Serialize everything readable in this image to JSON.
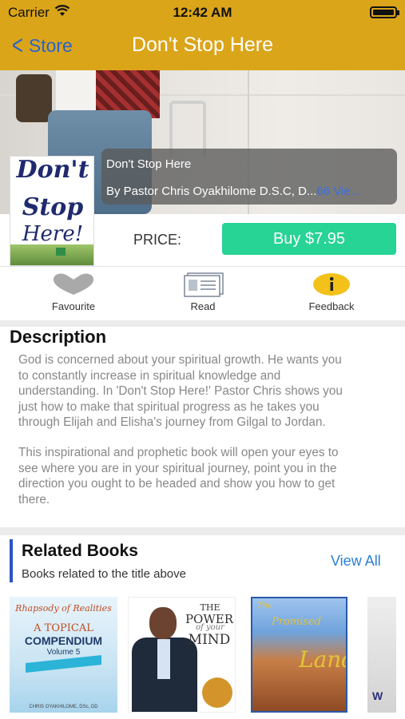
{
  "status_bar": {
    "carrier": "Carrier",
    "time": "12:42 AM"
  },
  "nav": {
    "back_label": "Store",
    "title": "Don't Stop Here"
  },
  "book": {
    "title": "Don't Stop Here",
    "author": "By Pastor Chris Oyakhilome D.S.C, D...",
    "views": "66 Vie...",
    "cover": {
      "line1": "Don't",
      "line2": "Stop",
      "line3": "Here!"
    }
  },
  "price": {
    "label": "PRICE:",
    "buy_label": "Buy $7.95"
  },
  "actions": [
    {
      "label": "Favourite",
      "icon": "heart-icon"
    },
    {
      "label": "Read",
      "icon": "book-icon"
    },
    {
      "label": "Feedback",
      "icon": "info-icon"
    }
  ],
  "description": {
    "heading": "Description",
    "paragraph1_lines": [
      "God is concerned about your spiritual growth. He wants you",
      "to constantly increase in spiritual knowledge and",
      "understanding. In 'Don't Stop Here!' Pastor Chris shows you",
      "just how to make that spiritual progress as he takes you",
      "through Elijah and Elisha's journey from Gilgal to Jordan."
    ],
    "paragraph2_lines": [
      "This inspirational and prophetic book will open your eyes to",
      "see where you are in your spiritual journey, point you in the",
      "direction you ought to be headed and show you how to get",
      "there."
    ]
  },
  "related": {
    "heading": "Related Books",
    "subheading": "Books related to the title above",
    "view_all": "View All",
    "books": [
      {
        "cover_lines": [
          "Rhapsody of Realities",
          "A TOPICAL",
          "COMPENDIUM",
          "Volume 5",
          "CHRIS OYAKHILOME, DSc, DD"
        ]
      },
      {
        "cover_lines": [
          "THE",
          "POWER",
          "of your",
          "MIND"
        ]
      },
      {
        "cover_lines": [
          "The",
          "Promised",
          "Land"
        ]
      },
      {
        "cover_lines": [
          "W"
        ]
      }
    ]
  },
  "colors": {
    "nav_bar": "#dba519",
    "buy_button": "#27d395",
    "accent_blue": "#2b7fd6",
    "description_text": "#888888"
  }
}
